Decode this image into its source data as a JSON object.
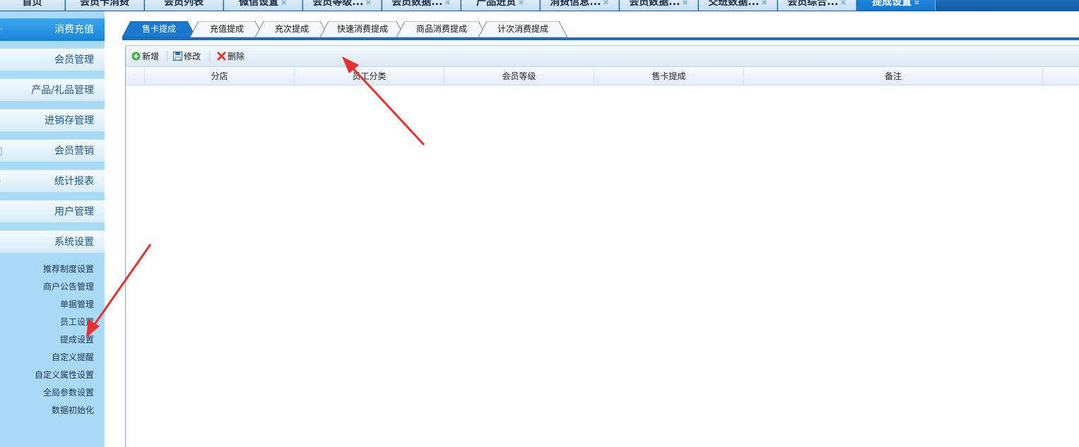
{
  "top_tabs": [
    {
      "label": "首页",
      "active": false
    },
    {
      "label": "会员卡消费",
      "active": false
    },
    {
      "label": "会员列表",
      "active": false
    },
    {
      "label": "微信设置",
      "active": false
    },
    {
      "label": "会员等级...",
      "active": false
    },
    {
      "label": "会员数据...",
      "active": false
    },
    {
      "label": "产品进货",
      "active": false
    },
    {
      "label": "消费信息...",
      "active": false
    },
    {
      "label": "会员数据...",
      "active": false
    },
    {
      "label": "交班数据...",
      "active": false
    },
    {
      "label": "会员综合...",
      "active": false
    },
    {
      "label": "提成设置",
      "active": true
    }
  ],
  "sidebar": {
    "header": "消费充值",
    "groups": [
      {
        "label": "会员管理"
      },
      {
        "label": "产品/礼品管理"
      },
      {
        "label": "进销存管理"
      },
      {
        "label": "会员营销"
      },
      {
        "label": "统计报表"
      },
      {
        "label": "用户管理"
      },
      {
        "label": "系统设置"
      }
    ],
    "sub_items": [
      {
        "label": "推荐制度设置"
      },
      {
        "label": "商户公告管理"
      },
      {
        "label": "单据管理"
      },
      {
        "label": "员工设置"
      },
      {
        "label": "提成设置"
      },
      {
        "label": "自定义提醒"
      },
      {
        "label": "自定义属性设置"
      },
      {
        "label": "全局参数设置"
      },
      {
        "label": "数据初始化"
      }
    ]
  },
  "content_tabs": [
    {
      "label": "售卡提成",
      "active": true
    },
    {
      "label": "充值提成",
      "active": false
    },
    {
      "label": "充次提成",
      "active": false
    },
    {
      "label": "快速消费提成",
      "active": false
    },
    {
      "label": "商品消费提成",
      "active": false
    },
    {
      "label": "计次消费提成",
      "active": false
    }
  ],
  "toolbar": {
    "add_label": "新增",
    "edit_label": "修改",
    "delete_label": "删除"
  },
  "grid": {
    "columns": [
      "分店",
      "员工分类",
      "会员等级",
      "售卡提成",
      "备注"
    ],
    "rows": []
  },
  "colors": {
    "accent": "#1b6fbf",
    "sidebar_bg": "#a8daf5",
    "annotation_arrow": "#e8312f"
  },
  "icons": {
    "add": "plus-circle-icon",
    "edit": "floppy-disk-icon",
    "delete": "red-x-icon",
    "tab_close": "close-icon"
  }
}
